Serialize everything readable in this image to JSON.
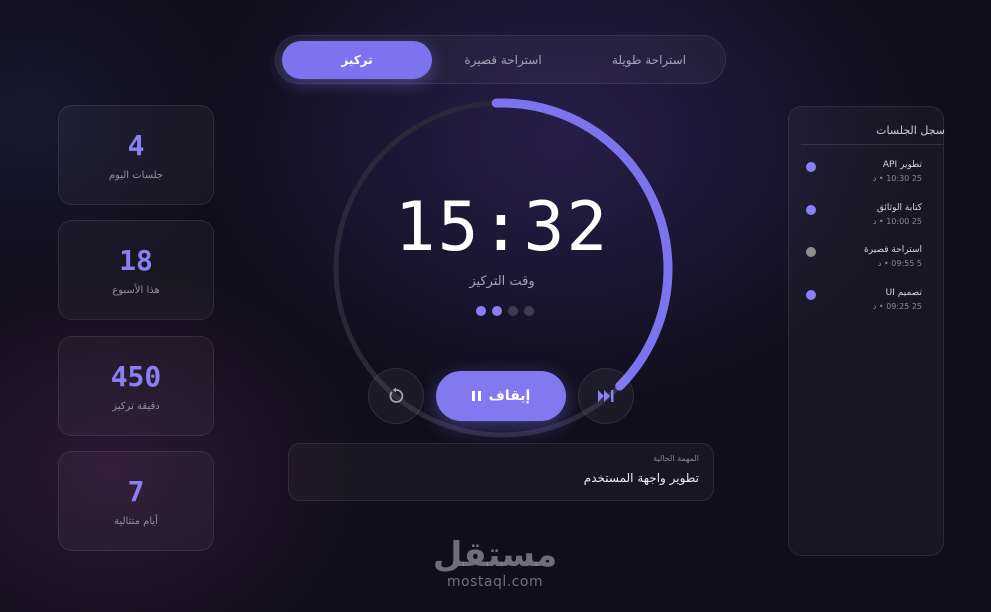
{
  "tabs": [
    {
      "label": "تركيز",
      "active": true
    },
    {
      "label": "استراحة قصيرة",
      "active": false
    },
    {
      "label": "استراحة طويلة",
      "active": false
    }
  ],
  "stats": [
    {
      "value": "4",
      "label": "جلسات اليوم"
    },
    {
      "value": "18",
      "label": "هذا الأسبوع"
    },
    {
      "value": "450",
      "label": "دقيقة تركيز"
    },
    {
      "value": "7",
      "label": "أيام متتالية"
    }
  ],
  "timer": {
    "time": "15:32",
    "label": "وقت التركيز",
    "progress": 0.38,
    "dots_total": 4,
    "dots_done": 2
  },
  "controls": {
    "pause_label": "إيقاف",
    "reset_icon": "reset-icon",
    "skip_icon": "skip-forward-icon"
  },
  "task": {
    "caption": "المهمة الحالية",
    "name": "تطوير واجهة المستخدم"
  },
  "log": {
    "title": "سجل الجلسات",
    "items": [
      {
        "name": "تطوير API",
        "time": "25 10:30 • د",
        "color": "#8a80f4"
      },
      {
        "name": "كتابة الوثائق",
        "time": "25 10:00 • د",
        "color": "#8a80f4"
      },
      {
        "name": "استراحة قصيرة",
        "time": "5 09:55 • د",
        "color": "#8a9288"
      },
      {
        "name": "تصميم UI",
        "time": "25 09:25 • د",
        "color": "#8a80f4"
      }
    ]
  },
  "watermark": {
    "logo": "مستقل",
    "url": "mostaql.com"
  },
  "colors": {
    "accent": "#8278f0",
    "background": "#100e1c",
    "ring_track": "#2a2838"
  }
}
